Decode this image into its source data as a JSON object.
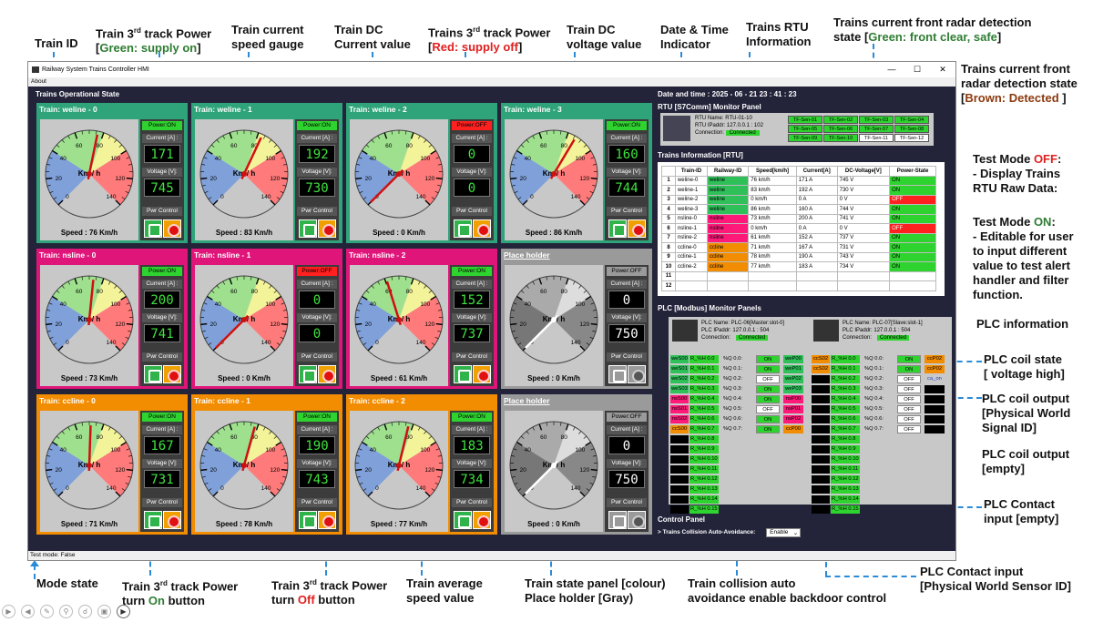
{
  "annotations": {
    "train_id": "Train ID",
    "power_on_a": "Train 3",
    "power_on_sup": "rd",
    "power_on_b": " track Power",
    "power_on_c": "[",
    "power_on_d": "Green: supply on",
    "power_on_e": "]",
    "gauge_a": "Train current",
    "gauge_b": "speed gauge",
    "current_a": "Train DC",
    "current_b": "Current value",
    "power_off_a": "Trains 3",
    "power_off_sup": "rd",
    "power_off_b": " track Power",
    "power_off_c": "[",
    "power_off_d": "Red: supply off",
    "power_off_e": "]",
    "voltage_a": "Train DC",
    "voltage_b": "voltage value",
    "date_a": "Date & Time",
    "date_b": "Indicator",
    "rtu_a": "Trains RTU",
    "rtu_b": "Information",
    "radar_a": "Trains current front radar detection",
    "radar_b": "state [",
    "radar_c": "Green: front clear, safe",
    "radar_d": "]",
    "radar2_a": "Trains current front",
    "radar2_b": "radar detection state",
    "radar2_c": "[",
    "radar2_d": "Brown: Detected",
    "radar2_e": " ]",
    "testoff_a": "Test Mode ",
    "testoff_b": "OFF",
    "testoff_c": ":",
    "testoff_d": "- Display Trains",
    "testoff_e": "RTU Raw Data:",
    "teston_a": "Test Mode ",
    "teston_b": "ON",
    "teston_c": ":",
    "teston_d": "- Editable for user",
    "teston_e": "to input different",
    "teston_f": "value to test alert",
    "teston_g": "handler and filter",
    "teston_h": "function.",
    "plcinfo": "PLC information",
    "coilstate_a": "PLC coil state",
    "coilstate_b": "[ voltage high]",
    "coilout_a": "PLC coil output",
    "coilout_b": "[Physical World",
    "coilout_c": "Signal ID]",
    "coilempty_a": "PLC coil output",
    "coilempty_b": "[empty]",
    "contactempty_a": "PLC Contact",
    "contactempty_b": "input [empty]",
    "contactin_a": "PLC Contact input",
    "contactin_b": "[Physical World Sensor ID]",
    "mode": "Mode state",
    "onbtn_a": "Train 3",
    "onbtn_sup": "rd",
    "onbtn_b": " track Power",
    "onbtn_c": "turn ",
    "onbtn_d": "On",
    "onbtn_e": " button",
    "offbtn_a": "Train 3",
    "offbtn_sup": "rd",
    "offbtn_b": " track Power",
    "offbtn_c": "turn ",
    "offbtn_d": "Off",
    "offbtn_e": " button",
    "avg_a": "Train average",
    "avg_b": "speed value",
    "panel_a": "Train state panel [colour)",
    "panel_b": "Place holder [Gray)",
    "collision_a": "Train collision auto",
    "collision_b": "avoidance enable backdoor control"
  },
  "window": {
    "title": "Railway System Trains Controller HMI",
    "menu": "About",
    "status": "Test mode: False",
    "section": "Trains Operational State"
  },
  "labels": {
    "current": "Current [A] :",
    "voltage": "Voltage [V]:",
    "pwr": "Pwr Control",
    "kmh": "Km / h",
    "speed_prefix": "Speed : ",
    "speed_suffix": " Km/h"
  },
  "trains": [
    {
      "name": "Train: weline - 0",
      "color": "#2fa37a",
      "power": "Power:ON",
      "speed": 76,
      "current": "171",
      "voltage": "745"
    },
    {
      "name": "Train: weline - 1",
      "color": "#2fa37a",
      "power": "Power:ON",
      "speed": 83,
      "current": "192",
      "voltage": "730"
    },
    {
      "name": "Train: weline - 2",
      "color": "#2fa37a",
      "power": "Power:OFF",
      "speed": 0,
      "current": "0",
      "voltage": "0"
    },
    {
      "name": "Train: weline - 3",
      "color": "#2fa37a",
      "power": "Power:ON",
      "speed": 86,
      "current": "160",
      "voltage": "744"
    },
    {
      "name": "Train: nsline - 0",
      "color": "#e0157a",
      "power": "Power:ON",
      "speed": 73,
      "current": "200",
      "voltage": "741"
    },
    {
      "name": "Train: nsline - 1",
      "color": "#e0157a",
      "power": "Power:OFF",
      "speed": 0,
      "current": "0",
      "voltage": "0"
    },
    {
      "name": "Train: nsline - 2",
      "color": "#e0157a",
      "power": "Power:ON",
      "speed": 61,
      "current": "152",
      "voltage": "737"
    },
    {
      "name": "Place holder",
      "color": "#9a9a9a",
      "power": "Power:OFF",
      "speed": 0,
      "current": "0",
      "voltage": "750",
      "ph": true
    },
    {
      "name": "Train: ccline - 0",
      "color": "#f28c00",
      "power": "Power:ON",
      "speed": 71,
      "current": "167",
      "voltage": "731"
    },
    {
      "name": "Train: ccline - 1",
      "color": "#f28c00",
      "power": "Power:ON",
      "speed": 78,
      "current": "190",
      "voltage": "743"
    },
    {
      "name": "Train: ccline - 2",
      "color": "#f28c00",
      "power": "Power:ON",
      "speed": 77,
      "current": "183",
      "voltage": "734"
    },
    {
      "name": "Place holder",
      "color": "#9a9a9a",
      "power": "Power:OFF",
      "speed": 0,
      "current": "0",
      "voltage": "750",
      "ph": true
    }
  ],
  "gauge_ticks": [
    "0",
    "20",
    "40",
    "60",
    "80",
    "100",
    "120",
    "140"
  ],
  "datetime": "Date and time :  2025 - 06 - 21 23 : 41 : 23",
  "rtu": {
    "title": "RTU [S7Comm] Monitor Panel",
    "name": "RTU Name:     RTU-01-10",
    "ip": "RTU IPaddr:   127.0.0.1 : 102",
    "conn_label": "Connection:",
    "conn": "Connected",
    "sensors": [
      {
        "id": "TF-Sen-01",
        "s": "g"
      },
      {
        "id": "TF-Sen-02",
        "s": "g"
      },
      {
        "id": "TF-Sen-03",
        "s": "g"
      },
      {
        "id": "TF-Sen-04",
        "s": "g"
      },
      {
        "id": "TF-Sen-05",
        "s": "g"
      },
      {
        "id": "TF-Sen-06",
        "s": "g"
      },
      {
        "id": "TF-Sen-07",
        "s": "g"
      },
      {
        "id": "TF-Sen-08",
        "s": "g"
      },
      {
        "id": "TF-Sen-09",
        "s": "g"
      },
      {
        "id": "TF-Sen-10",
        "s": "g"
      },
      {
        "id": "TF-Sen-11",
        "s": "w"
      },
      {
        "id": "TF-Sen-12",
        "s": "w"
      }
    ]
  },
  "train_info": {
    "title": "Trains Information [RTU]",
    "headers": [
      "",
      "Train-ID",
      "Railway-ID",
      "Speed[km/h]",
      "Current[A]",
      "DC-Voltage[V]",
      "Power-State"
    ],
    "rows": [
      [
        "1",
        "weline-0",
        "weline",
        "76 km/h",
        "171 A",
        "745 V",
        "ON"
      ],
      [
        "2",
        "weline-1",
        "weline",
        "83 km/h",
        "192 A",
        "730 V",
        "ON"
      ],
      [
        "3",
        "weline-2",
        "weline",
        "0 km/h",
        "0 A",
        "0 V",
        "OFF"
      ],
      [
        "4",
        "weline-3",
        "weline",
        "86 km/h",
        "160 A",
        "744 V",
        "ON"
      ],
      [
        "5",
        "nsline-0",
        "nsline",
        "73 km/h",
        "200 A",
        "741 V",
        "ON"
      ],
      [
        "6",
        "nsline-1",
        "nsline",
        "0 km/h",
        "0 A",
        "0 V",
        "OFF"
      ],
      [
        "7",
        "nsline-2",
        "nsline",
        "61 km/h",
        "152 A",
        "737 V",
        "ON"
      ],
      [
        "8",
        "ccline-0",
        "ccline",
        "71 km/h",
        "167 A",
        "731 V",
        "ON"
      ],
      [
        "9",
        "ccline-1",
        "ccline",
        "78 km/h",
        "190 A",
        "743 V",
        "ON"
      ],
      [
        "10",
        "ccline-2",
        "ccline",
        "77 km/h",
        "183 A",
        "734 V",
        "ON"
      ],
      [
        "11",
        "",
        "",
        "",
        "",
        "",
        ""
      ],
      [
        "12",
        "",
        "",
        "",
        "",
        "",
        ""
      ]
    ]
  },
  "plc_title": "PLC [Modbus] Monitor Panels",
  "plc": [
    {
      "name": "PLC Name:   PLC-06[Master:slot-0]",
      "ip": "PLC IPaddr:  127.0.0.1 : 504",
      "conn_label": "Connection:",
      "conn": "Connected",
      "coils": [
        [
          "weS00",
          "R_%H 0.0",
          "%Q 0.0:",
          "ON",
          "weP00"
        ],
        [
          "weS01",
          "R_%H 0.1",
          "%Q 0.1:",
          "ON",
          "weP01"
        ],
        [
          "weS02",
          "R_%H 0.2",
          "%Q 0.2:",
          "OFF",
          "weP02"
        ],
        [
          "weS03",
          "R_%H 0.3",
          "%Q 0.3:",
          "ON",
          "weP03"
        ],
        [
          "nsS00",
          "R_%H 0.4",
          "%Q 0.4:",
          "ON",
          "nsP00"
        ],
        [
          "nsS01",
          "R_%H 0.5",
          "%Q 0.5:",
          "OFF",
          "nsP01"
        ],
        [
          "nsS02",
          "R_%H 0.6",
          "%Q 0.6:",
          "ON",
          "nsP02"
        ],
        [
          "ccS00",
          "R_%H 0.7",
          "%Q 0.7:",
          "ON",
          "ccP00"
        ]
      ],
      "extra": [
        "R_%H 0.8",
        "R_%H 0.9",
        "R_%H 0.10",
        "R_%H 0.11",
        "R_%H 0.12",
        "R_%H 0.13",
        "R_%H 0.14",
        "R_%H 0.15"
      ]
    },
    {
      "name": "PLC Name:   PLC-07[Slave:slot-1]",
      "ip": "PLC IPaddr:  127.0.0.1 : 504",
      "conn_label": "Connection:",
      "conn": "Connected",
      "coils": [
        [
          "ccS02",
          "R_%H 0.0",
          "%Q 0.0:",
          "ON",
          "ccP02"
        ],
        [
          "ccS02",
          "R_%H 0.1",
          "%Q 0.1:",
          "ON",
          "ccP02"
        ],
        [
          "",
          "R_%H 0.2",
          "%Q 0.2:",
          "OFF",
          "ca_on"
        ],
        [
          "",
          "R_%H 0.3",
          "%Q 0.3:",
          "OFF",
          ""
        ],
        [
          "",
          "R_%H 0.4",
          "%Q 0.4:",
          "OFF",
          ""
        ],
        [
          "",
          "R_%H 0.5",
          "%Q 0.5:",
          "OFF",
          ""
        ],
        [
          "",
          "R_%H 0.6",
          "%Q 0.6:",
          "OFF",
          ""
        ],
        [
          "",
          "R_%H 0.7",
          "%Q 0.7:",
          "OFF",
          ""
        ]
      ],
      "extra": [
        "R_%H 0.8",
        "R_%H 0.9",
        "R_%H 0.10",
        "R_%H 0.11",
        "R_%H 0.12",
        "R_%H 0.13",
        "R_%H 0.14",
        "R_%H 0.15"
      ]
    }
  ],
  "control": {
    "title": "Control Panel",
    "label": "> Trains Collision Auto-Avoidance:",
    "value": "Enable"
  },
  "colors": {
    "green": "#2fd32f",
    "red": "#ff2020",
    "nsline": "#ff1a7a",
    "ccline": "#f28c00",
    "weline": "#2fc05a",
    "brown": "#c45a10"
  }
}
